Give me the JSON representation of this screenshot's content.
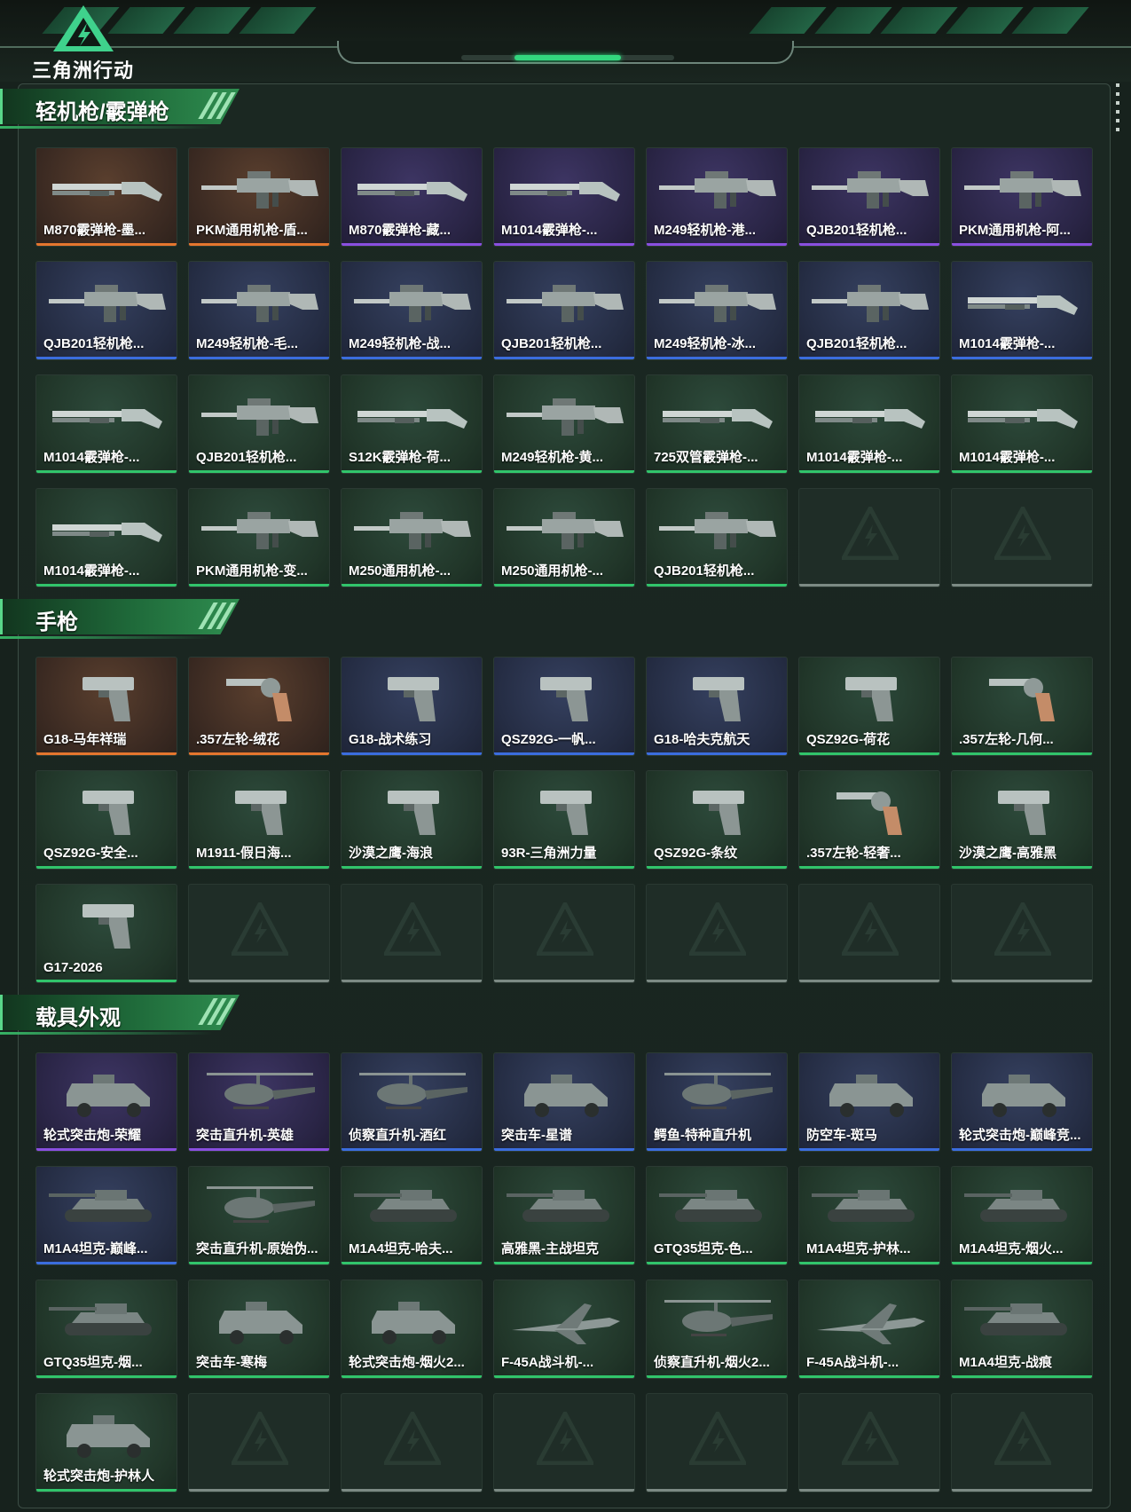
{
  "app": {
    "logo_text": "三角洲行动",
    "colors": {
      "accent_green": "#33d67e",
      "rarity_orange": "#e5762e",
      "rarity_blue": "#3b6dde",
      "rarity_purple": "#8a4fe0",
      "rarity_green": "#31c46b"
    }
  },
  "sections": [
    {
      "title": "轻机枪/霰弹枪",
      "items": [
        {
          "label": "M870霰弹枪-墨...",
          "rarity": "orange",
          "icon": "shotgun-icon"
        },
        {
          "label": "PKM通用机枪-盾...",
          "rarity": "orange",
          "icon": "machine-gun-icon"
        },
        {
          "label": "M870霰弹枪-藏...",
          "rarity": "purple",
          "icon": "shotgun-icon"
        },
        {
          "label": "M1014霰弹枪-...",
          "rarity": "purple",
          "icon": "shotgun-icon"
        },
        {
          "label": "M249轻机枪-港...",
          "rarity": "purple",
          "icon": "machine-gun-icon"
        },
        {
          "label": "QJB201轻机枪...",
          "rarity": "purple",
          "icon": "machine-gun-icon"
        },
        {
          "label": "PKM通用机枪-阿...",
          "rarity": "purple",
          "icon": "machine-gun-icon"
        },
        {
          "label": "QJB201轻机枪...",
          "rarity": "blue",
          "icon": "machine-gun-icon"
        },
        {
          "label": "M249轻机枪-毛...",
          "rarity": "blue",
          "icon": "machine-gun-icon"
        },
        {
          "label": "M249轻机枪-战...",
          "rarity": "blue",
          "icon": "machine-gun-icon"
        },
        {
          "label": "QJB201轻机枪...",
          "rarity": "blue",
          "icon": "machine-gun-icon"
        },
        {
          "label": "M249轻机枪-冰...",
          "rarity": "blue",
          "icon": "machine-gun-icon"
        },
        {
          "label": "QJB201轻机枪...",
          "rarity": "blue",
          "icon": "machine-gun-icon"
        },
        {
          "label": "M1014霰弹枪-...",
          "rarity": "blue",
          "icon": "shotgun-icon"
        },
        {
          "label": "M1014霰弹枪-...",
          "rarity": "green",
          "icon": "shotgun-icon"
        },
        {
          "label": "QJB201轻机枪...",
          "rarity": "green",
          "icon": "machine-gun-icon"
        },
        {
          "label": "S12K霰弹枪-荷...",
          "rarity": "green",
          "icon": "shotgun-icon"
        },
        {
          "label": "M249轻机枪-黄...",
          "rarity": "green",
          "icon": "machine-gun-icon"
        },
        {
          "label": "725双管霰弹枪-...",
          "rarity": "green",
          "icon": "shotgun-icon"
        },
        {
          "label": "M1014霰弹枪-...",
          "rarity": "green",
          "icon": "shotgun-icon"
        },
        {
          "label": "M1014霰弹枪-...",
          "rarity": "green",
          "icon": "shotgun-icon"
        },
        {
          "label": "M1014霰弹枪-...",
          "rarity": "green",
          "icon": "shotgun-icon"
        },
        {
          "label": "PKM通用机枪-变...",
          "rarity": "green",
          "icon": "machine-gun-icon"
        },
        {
          "label": "M250通用机枪-...",
          "rarity": "green",
          "icon": "machine-gun-icon"
        },
        {
          "label": "M250通用机枪-...",
          "rarity": "green",
          "icon": "machine-gun-icon"
        },
        {
          "label": "QJB201轻机枪...",
          "rarity": "green",
          "icon": "machine-gun-icon"
        },
        {
          "label": "",
          "rarity": "empty",
          "icon": ""
        },
        {
          "label": "",
          "rarity": "empty",
          "icon": ""
        }
      ]
    },
    {
      "title": "手枪",
      "items": [
        {
          "label": "G18-马年祥瑞",
          "rarity": "orange",
          "icon": "pistol-icon"
        },
        {
          "label": ".357左轮-绒花",
          "rarity": "orange",
          "icon": "revolver-icon"
        },
        {
          "label": "G18-战术练习",
          "rarity": "blue",
          "icon": "pistol-icon"
        },
        {
          "label": "QSZ92G-一帆...",
          "rarity": "blue",
          "icon": "pistol-icon"
        },
        {
          "label": "G18-哈夫克航天",
          "rarity": "blue",
          "icon": "pistol-icon"
        },
        {
          "label": "QSZ92G-荷花",
          "rarity": "green",
          "icon": "pistol-icon"
        },
        {
          "label": ".357左轮-几何...",
          "rarity": "green",
          "icon": "revolver-icon"
        },
        {
          "label": "QSZ92G-安全...",
          "rarity": "green",
          "icon": "pistol-icon"
        },
        {
          "label": "M1911-假日海...",
          "rarity": "green",
          "icon": "pistol-icon"
        },
        {
          "label": "沙漠之鹰-海浪",
          "rarity": "green",
          "icon": "pistol-icon"
        },
        {
          "label": "93R-三角洲力量",
          "rarity": "green",
          "icon": "pistol-icon"
        },
        {
          "label": "QSZ92G-条纹",
          "rarity": "green",
          "icon": "pistol-icon"
        },
        {
          "label": ".357左轮-轻奢...",
          "rarity": "green",
          "icon": "revolver-icon"
        },
        {
          "label": "沙漠之鹰-高雅黑",
          "rarity": "green",
          "icon": "pistol-icon"
        },
        {
          "label": "G17-2026",
          "rarity": "green",
          "icon": "pistol-icon"
        },
        {
          "label": "",
          "rarity": "empty",
          "icon": ""
        },
        {
          "label": "",
          "rarity": "empty",
          "icon": ""
        },
        {
          "label": "",
          "rarity": "empty",
          "icon": ""
        },
        {
          "label": "",
          "rarity": "empty",
          "icon": ""
        },
        {
          "label": "",
          "rarity": "empty",
          "icon": ""
        },
        {
          "label": "",
          "rarity": "empty",
          "icon": ""
        }
      ]
    },
    {
      "title": "载具外观",
      "items": [
        {
          "label": "轮式突击炮-荣耀",
          "rarity": "purple",
          "icon": "armored-car-icon"
        },
        {
          "label": "突击直升机-英雄",
          "rarity": "purple",
          "icon": "helicopter-icon"
        },
        {
          "label": "侦察直升机-酒红",
          "rarity": "blue",
          "icon": "helicopter-icon"
        },
        {
          "label": "突击车-星谱",
          "rarity": "blue",
          "icon": "armored-car-icon"
        },
        {
          "label": "鳄鱼-特种直升机",
          "rarity": "blue",
          "icon": "helicopter-icon"
        },
        {
          "label": "防空车-斑马",
          "rarity": "blue",
          "icon": "armored-car-icon"
        },
        {
          "label": "轮式突击炮-巅峰竞...",
          "rarity": "blue",
          "icon": "armored-car-icon"
        },
        {
          "label": "M1A4坦克-巅峰...",
          "rarity": "blue",
          "icon": "tank-icon"
        },
        {
          "label": "突击直升机-原始伪...",
          "rarity": "green",
          "icon": "helicopter-icon"
        },
        {
          "label": "M1A4坦克-哈夫...",
          "rarity": "green",
          "icon": "tank-icon"
        },
        {
          "label": "高雅黑-主战坦克",
          "rarity": "green",
          "icon": "tank-icon"
        },
        {
          "label": "GTQ35坦克-色...",
          "rarity": "green",
          "icon": "tank-icon"
        },
        {
          "label": "M1A4坦克-护林...",
          "rarity": "green",
          "icon": "tank-icon"
        },
        {
          "label": "M1A4坦克-烟火...",
          "rarity": "green",
          "icon": "tank-icon"
        },
        {
          "label": "GTQ35坦克-烟...",
          "rarity": "green",
          "icon": "tank-icon"
        },
        {
          "label": "突击车-寒梅",
          "rarity": "green",
          "icon": "armored-car-icon"
        },
        {
          "label": "轮式突击炮-烟火2...",
          "rarity": "green",
          "icon": "armored-car-icon"
        },
        {
          "label": "F-45A战斗机-...",
          "rarity": "green",
          "icon": "jet-icon"
        },
        {
          "label": "侦察直升机-烟火2...",
          "rarity": "green",
          "icon": "helicopter-icon"
        },
        {
          "label": "F-45A战斗机-...",
          "rarity": "green",
          "icon": "jet-icon"
        },
        {
          "label": "M1A4坦克-战痕",
          "rarity": "green",
          "icon": "tank-icon"
        },
        {
          "label": "轮式突击炮-护林人",
          "rarity": "green",
          "icon": "armored-car-icon"
        },
        {
          "label": "",
          "rarity": "empty",
          "icon": ""
        },
        {
          "label": "",
          "rarity": "empty",
          "icon": ""
        },
        {
          "label": "",
          "rarity": "empty",
          "icon": ""
        },
        {
          "label": "",
          "rarity": "empty",
          "icon": ""
        },
        {
          "label": "",
          "rarity": "empty",
          "icon": ""
        },
        {
          "label": "",
          "rarity": "empty",
          "icon": ""
        }
      ]
    }
  ]
}
